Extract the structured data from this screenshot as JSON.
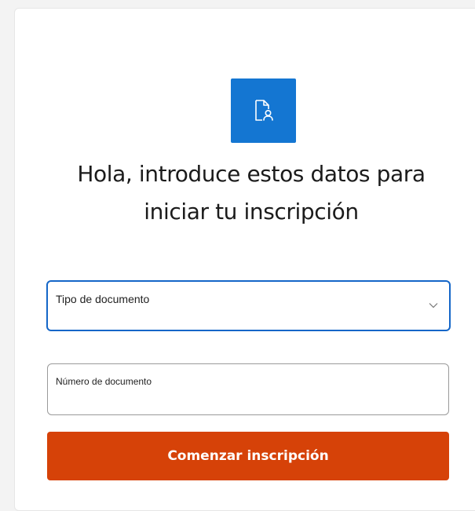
{
  "form": {
    "heading_line1": "Hola, introduce estos datos para",
    "heading_line2": "iniciar tu inscripción",
    "document_type_label": "Tipo de documento",
    "document_number_label": "Número de documento",
    "document_number_value": "",
    "submit_label": "Comenzar inscripción"
  },
  "icons": {
    "logo": "document-user-icon",
    "select": "chevron-down-icon"
  },
  "colors": {
    "logo_background": "#1476d2",
    "focus_border": "#1466c8",
    "submit_background": "#d64208",
    "submit_text": "#ffffff"
  }
}
